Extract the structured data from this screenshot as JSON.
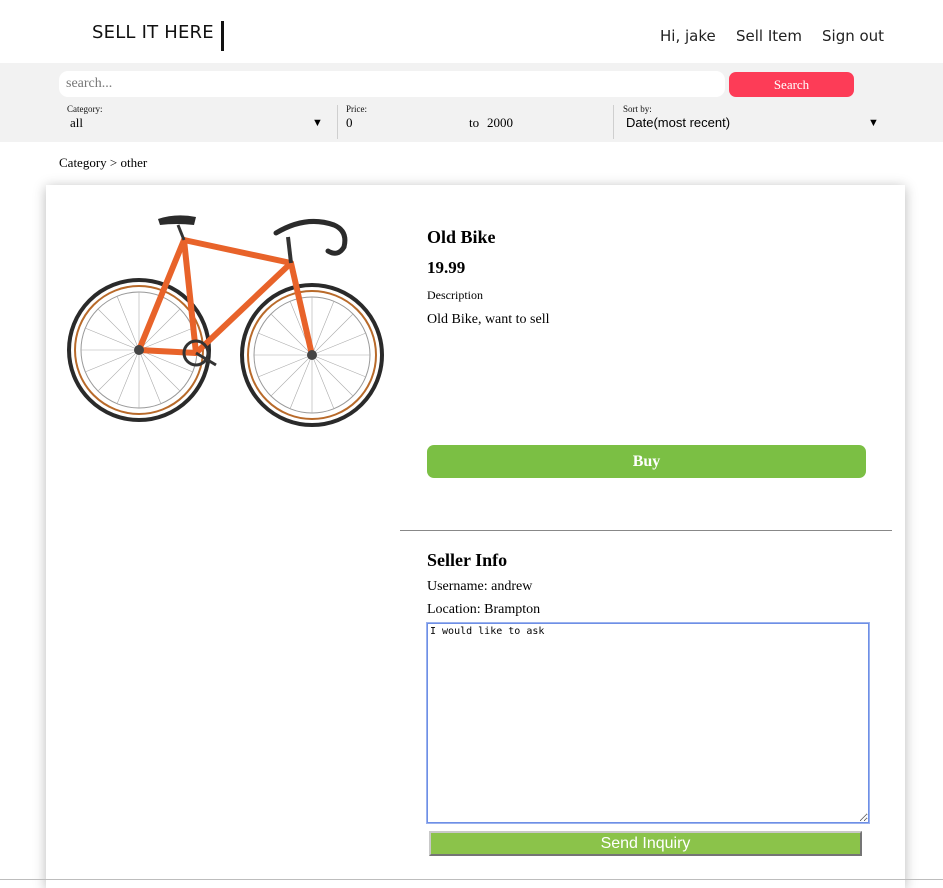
{
  "header": {
    "logo": "SELL IT HERE",
    "nav": {
      "greeting": "Hi, jake",
      "sell": "Sell Item",
      "signout": "Sign out"
    }
  },
  "search": {
    "placeholder": "search...",
    "button": "Search"
  },
  "filters": {
    "category": {
      "label": "Category:",
      "value": "all"
    },
    "price": {
      "label": "Price:",
      "min": "0",
      "to": "to",
      "max": "2000"
    },
    "sort": {
      "label": "Sort by:",
      "value": "Date(most recent)"
    },
    "caret": "▼"
  },
  "breadcrumb": "Category > other",
  "product": {
    "title": "Old Bike",
    "price": "19.99",
    "description_label": "Description",
    "description": "Old Bike, want to sell",
    "buy_label": "Buy",
    "image_icon": "bicycle-image"
  },
  "seller": {
    "title": "Seller Info",
    "username": "Username: andrew",
    "location": "Location: Brampton"
  },
  "inquiry": {
    "value": "I would like to ask",
    "send_label": "Send Inquiry"
  },
  "colors": {
    "accent_red": "#fd3c57",
    "buy_green": "#7bbf44",
    "send_green": "#8bc34a",
    "bike_orange": "#e8632a"
  }
}
